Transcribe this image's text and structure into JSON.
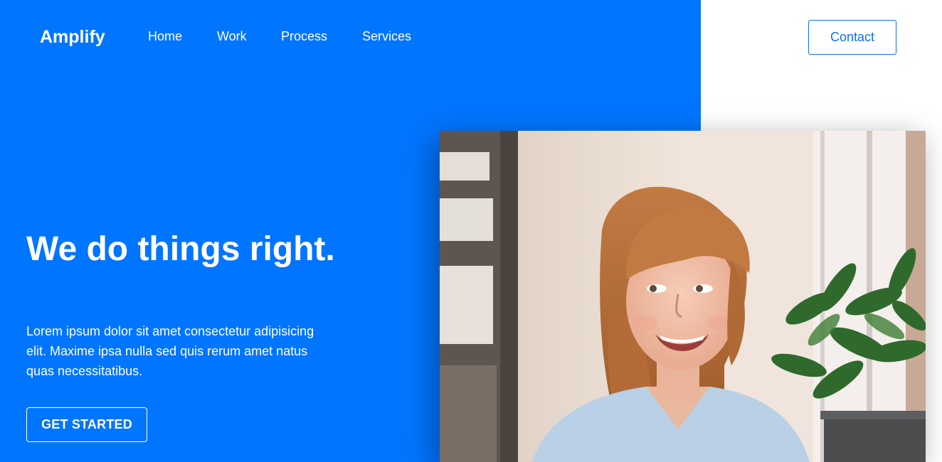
{
  "brand": {
    "name": "Amplify"
  },
  "nav": {
    "items": [
      {
        "label": "Home"
      },
      {
        "label": "Work"
      },
      {
        "label": "Process"
      },
      {
        "label": "Services"
      }
    ],
    "contact_label": "Contact"
  },
  "hero": {
    "headline": "We do things right.",
    "description": "Lorem ipsum dolor sit amet consectetur adipisicing elit. Maxime ipsa nulla sed quis rerum amet natus quas necessitatibus.",
    "cta_label": "GET STARTED"
  },
  "colors": {
    "accent": "#0075ff",
    "button_blue": "#0d6efd",
    "white": "#ffffff"
  }
}
